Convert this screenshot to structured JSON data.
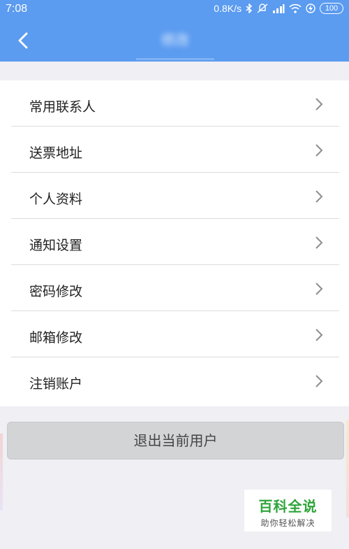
{
  "status_bar": {
    "time": "7:08",
    "network_speed": "0.8K/s",
    "battery": "100",
    "icons": [
      "bluetooth-icon",
      "mute-icon",
      "signal-icon",
      "wifi-icon",
      "charging-icon",
      "battery-icon"
    ]
  },
  "nav": {
    "back_icon": "chevron-left-icon",
    "title": "修改"
  },
  "menu": {
    "items": [
      {
        "label": "常用联系人"
      },
      {
        "label": "送票地址"
      },
      {
        "label": "个人资料"
      },
      {
        "label": "通知设置"
      },
      {
        "label": "密码修改"
      },
      {
        "label": "邮箱修改"
      },
      {
        "label": "注销账户"
      }
    ],
    "chevron_icon": "chevron-right-icon"
  },
  "logout_label": "退出当前用户",
  "watermark": {
    "title": "百科全说",
    "subtitle": "助你轻松解决"
  },
  "colors": {
    "header_blue": "#5b9bf0",
    "background": "#efeff4",
    "button_gray": "#d3d4d6",
    "watermark_green": "#2ea43a"
  }
}
